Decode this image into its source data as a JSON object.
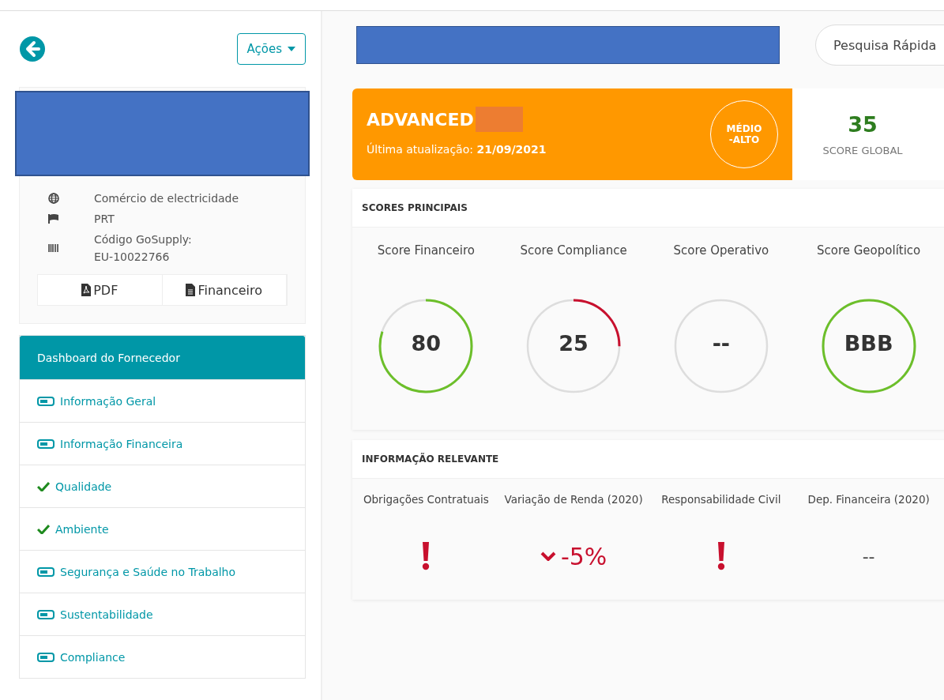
{
  "sidebar": {
    "actions_button": "Ações",
    "profile": {
      "rows": [
        {
          "kind": "globe",
          "lines": [
            "Comércio de electricidade"
          ]
        },
        {
          "kind": "flag",
          "lines": [
            "PRT"
          ]
        },
        {
          "kind": "barcode",
          "lines": [
            "Código GoSupply:",
            "EU-10022766"
          ]
        }
      ],
      "buttons": [
        {
          "kind": "pdf",
          "label": "PDF"
        },
        {
          "kind": "file",
          "label": "Financeiro"
        }
      ]
    },
    "menu": {
      "title": "Dashboard do Fornecedor",
      "items": [
        {
          "label": "Informação Geral",
          "kind": "pending"
        },
        {
          "label": "Informação Financeira",
          "kind": "pending"
        },
        {
          "label": "Qualidade",
          "kind": "done"
        },
        {
          "label": "Ambiente",
          "kind": "done"
        },
        {
          "label": "Segurança e Saúde no Trabalho",
          "kind": "pending"
        },
        {
          "label": "Sustentabilidade",
          "kind": "pending"
        },
        {
          "label": "Compliance",
          "kind": "pending"
        }
      ]
    }
  },
  "search": {
    "placeholder": "Pesquisa Rápida"
  },
  "banner": {
    "title": "ADVANCED",
    "update_label": "Última atualização:",
    "update_date": "21/09/2021",
    "risk": [
      "MÉDIO",
      "-ALTO"
    ],
    "score": "35",
    "score_label": "SCORE GLOBAL"
  },
  "scores": {
    "title": "SCORES PRINCIPAIS",
    "items": [
      {
        "label": "Score Financeiro",
        "value": "80",
        "color": "#6cbf2a"
      },
      {
        "label": "Score Compliance",
        "value": "25",
        "color": "#c8102e"
      },
      {
        "label": "Score Operativo",
        "value": "--"
      },
      {
        "label": "Score Geopolítico",
        "value": "BBB",
        "color": "#6cbf2a"
      }
    ]
  },
  "relevant": {
    "title": "INFORMAÇÃO RELEVANTE",
    "items": [
      {
        "label": "Obrigações Contratuais",
        "kind": "alert"
      },
      {
        "label": "Variação de Renda (2020)",
        "kind": "trend_down",
        "value": "-5%"
      },
      {
        "label": "Responsabilidade Civil",
        "kind": "alert"
      },
      {
        "label": "Dep. Financeira (2020)",
        "kind": "text",
        "value": "--"
      }
    ]
  }
}
